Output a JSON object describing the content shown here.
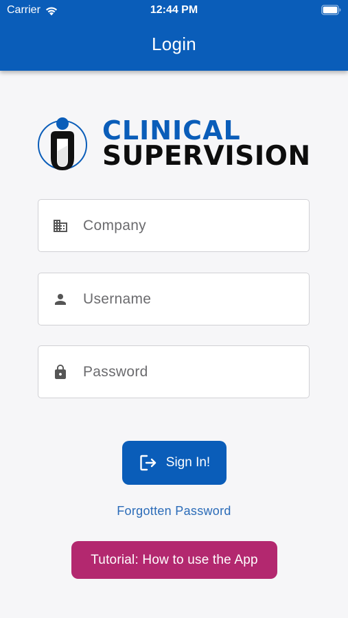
{
  "status_bar": {
    "carrier": "Carrier",
    "time": "12:44 PM",
    "icons": [
      "wifi-icon",
      "battery-icon"
    ]
  },
  "header": {
    "title": "Login",
    "background_color": "#0a5db9"
  },
  "logo": {
    "line1": "CLINICAL",
    "line2": "SUPERVISION",
    "line1_color": "#0a5db9",
    "line2_color": "#0d0d0d"
  },
  "form": {
    "company": {
      "placeholder": "Company",
      "value": "",
      "icon": "building-icon"
    },
    "username": {
      "placeholder": "Username",
      "value": "",
      "icon": "person-icon"
    },
    "password": {
      "placeholder": "Password",
      "value": "",
      "icon": "lock-icon"
    }
  },
  "actions": {
    "sign_in_label": "Sign In!",
    "sign_in_icon": "login-icon",
    "sign_in_color": "#0a5db9",
    "forgot_password_label": "Forgotten Password",
    "tutorial_label": "Tutorial: How to use the App",
    "tutorial_color": "#b3286f"
  }
}
